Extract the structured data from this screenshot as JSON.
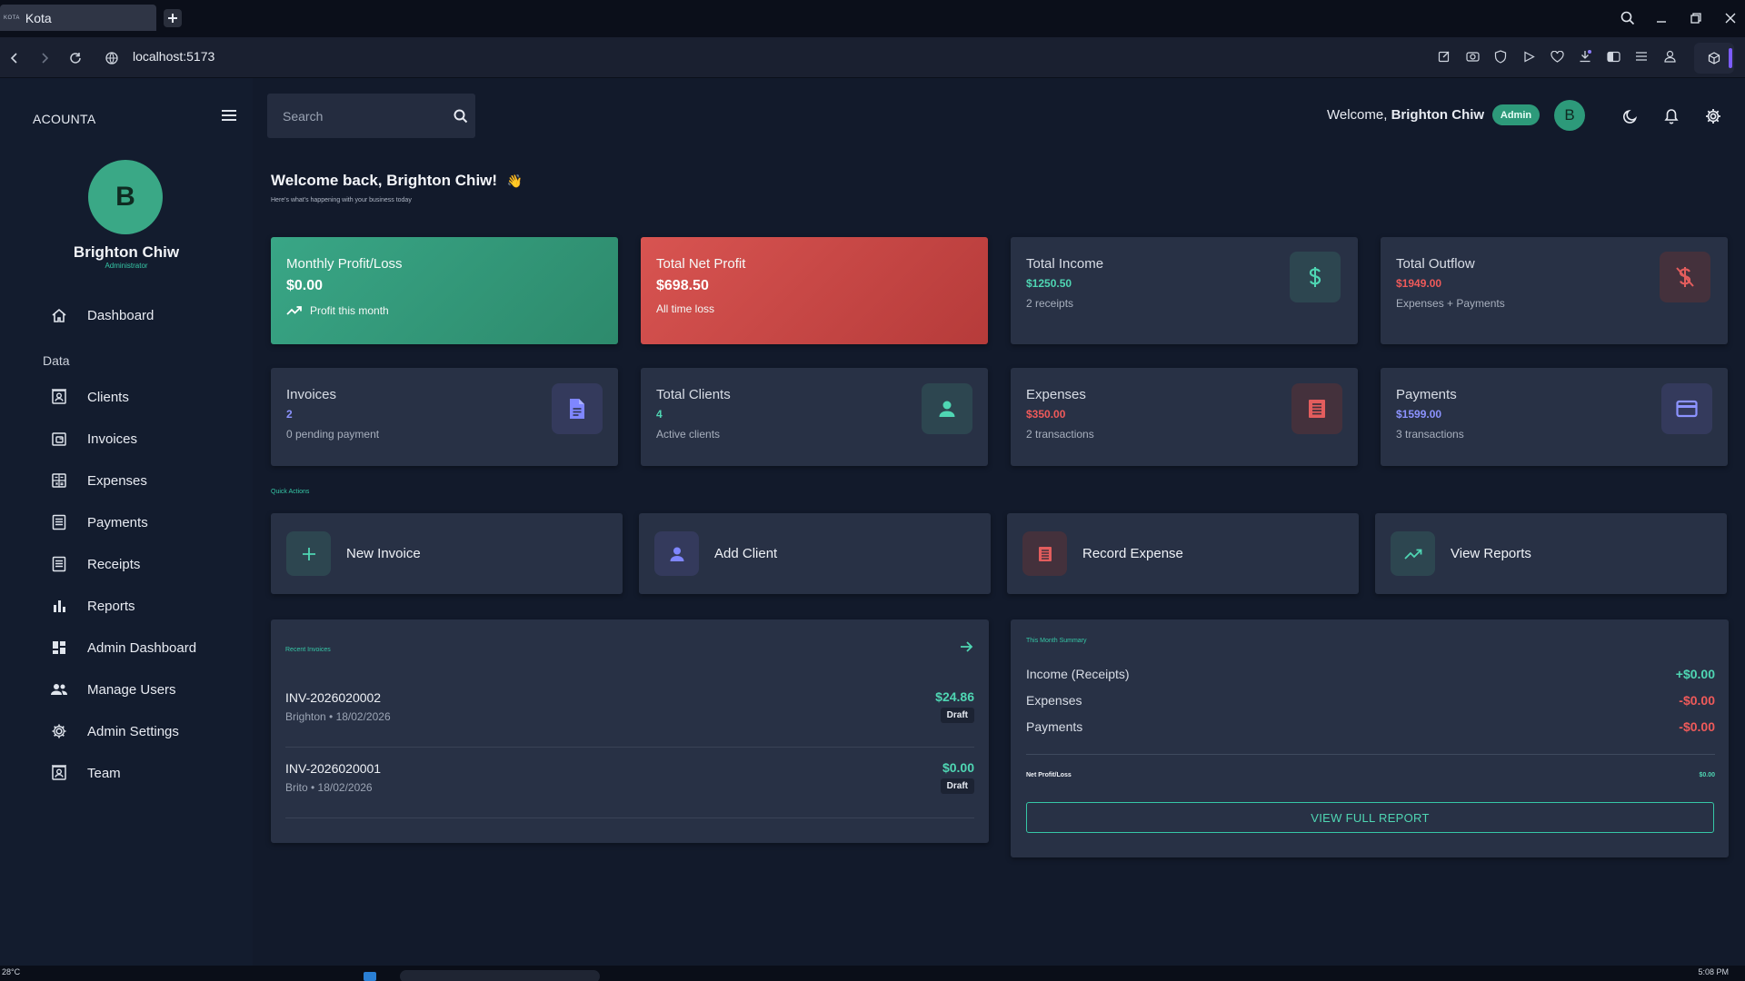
{
  "browser": {
    "tab_title": "Kota",
    "tab_favicon_text": "KOTA",
    "url": "localhost:5173"
  },
  "sidebar": {
    "brand": "ACOUNTA",
    "avatar_initial": "B",
    "user_name": "Brighton Chiw",
    "user_role": "Administrator",
    "section_data": "Data",
    "items": [
      {
        "label": "Dashboard",
        "icon": "home-icon"
      },
      {
        "label": "Clients",
        "icon": "contact-icon"
      },
      {
        "label": "Invoices",
        "icon": "invoice-icon"
      },
      {
        "label": "Expenses",
        "icon": "calculator-icon"
      },
      {
        "label": "Payments",
        "icon": "list-icon"
      },
      {
        "label": "Receipts",
        "icon": "receipt-icon"
      },
      {
        "label": "Reports",
        "icon": "bar-chart-icon"
      },
      {
        "label": "Admin Dashboard",
        "icon": "dashboard-icon"
      },
      {
        "label": "Manage Users",
        "icon": "users-icon"
      },
      {
        "label": "Admin Settings",
        "icon": "gear-icon"
      },
      {
        "label": "Team",
        "icon": "contact-icon"
      }
    ]
  },
  "header": {
    "search_placeholder": "Search",
    "welcome_prefix": "Welcome,",
    "welcome_name": "Brighton Chiw",
    "role_badge": "Admin",
    "avatar_initial": "B"
  },
  "page": {
    "title": "Welcome back, Brighton Chiw!",
    "title_emoji": "👋",
    "subtitle": "Here's what's happening with your business today"
  },
  "stats_top": [
    {
      "title": "Monthly Profit/Loss",
      "value": "$0.00",
      "sub": "Profit this month"
    },
    {
      "title": "Total Net Profit",
      "value": "$698.50",
      "sub": "All time loss"
    },
    {
      "title": "Total Income",
      "value": "$1250.50",
      "sub": "2 receipts",
      "icon": "dollar-icon"
    },
    {
      "title": "Total Outflow",
      "value": "$1949.00",
      "sub": "Expenses + Payments",
      "icon": "dollar-off-icon"
    }
  ],
  "stats_bottom": [
    {
      "title": "Invoices",
      "value": "2",
      "sub": "0 pending payment",
      "icon": "document-icon"
    },
    {
      "title": "Total Clients",
      "value": "4",
      "sub": "Active clients",
      "icon": "person-icon"
    },
    {
      "title": "Expenses",
      "value": "$350.00",
      "sub": "2 transactions",
      "icon": "receipt-icon"
    },
    {
      "title": "Payments",
      "value": "$1599.00",
      "sub": "3 transactions",
      "icon": "credit-card-icon"
    }
  ],
  "quick_actions": {
    "label": "Quick Actions",
    "items": [
      {
        "label": "New Invoice",
        "icon": "plus-icon"
      },
      {
        "label": "Add Client",
        "icon": "person-icon"
      },
      {
        "label": "Record Expense",
        "icon": "receipt-icon"
      },
      {
        "label": "View Reports",
        "icon": "trending-up-icon"
      }
    ]
  },
  "recent_invoices": {
    "label": "Recent Invoices",
    "items": [
      {
        "number": "INV-2026020002",
        "meta": "Brighton • 18/02/2026",
        "amount": "$24.86",
        "status": "Draft"
      },
      {
        "number": "INV-2026020001",
        "meta": "Brito • 18/02/2026",
        "amount": "$0.00",
        "status": "Draft"
      }
    ]
  },
  "month_summary": {
    "label": "This Month Summary",
    "rows": [
      {
        "label": "Income (Receipts)",
        "value": "+$0.00"
      },
      {
        "label": "Expenses",
        "value": "-$0.00"
      },
      {
        "label": "Payments",
        "value": "-$0.00"
      }
    ],
    "net_label": "Net Profit/Loss",
    "net_value": "$0.00",
    "button": "VIEW FULL REPORT"
  },
  "taskbar": {
    "temp": "28°C",
    "time": "5:08 PM"
  },
  "colors": {
    "accent": "#36c7a6",
    "danger": "#ef5a5a",
    "indigo": "#8c93ff",
    "card": "#283145",
    "sidebar": "#131c2e"
  }
}
